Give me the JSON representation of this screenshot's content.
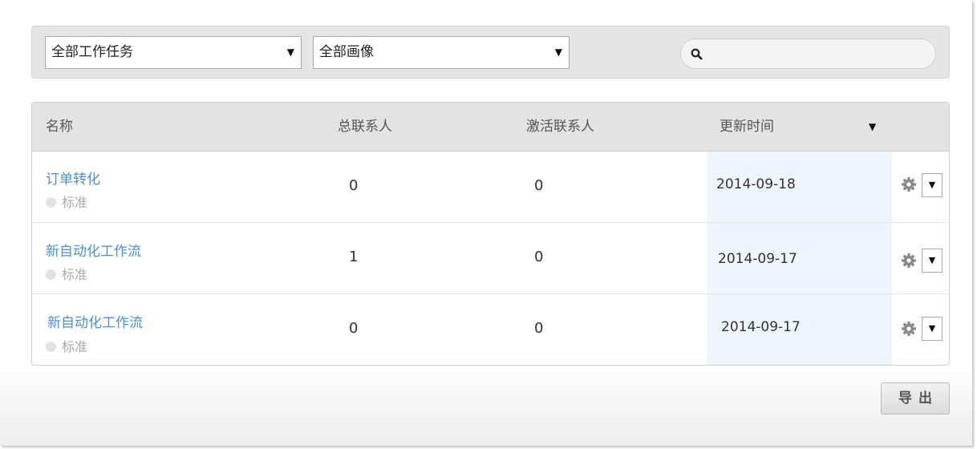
{
  "filters": {
    "task_select": "全部工作任务",
    "persona_select": "全部画像",
    "search_placeholder": ""
  },
  "table": {
    "headers": {
      "name": "名称",
      "total_contacts": "总联系人",
      "active_contacts": "激活联系人",
      "updated": "更新时间"
    },
    "rows": [
      {
        "name": "订单转化",
        "type": "标准",
        "total": "0",
        "active": "0",
        "updated": "2014-09-18"
      },
      {
        "name": "新自动化工作流",
        "type": "标准",
        "total": "1",
        "active": "0",
        "updated": "2014-09-17"
      },
      {
        "name": "新自动化工作流",
        "type": "标准",
        "total": "0",
        "active": "0",
        "updated": "2014-09-17"
      }
    ]
  },
  "export_label": "导出",
  "icons": [
    "search-icon",
    "gear-icon",
    "caret-down-icon"
  ],
  "colors": {
    "link": "#4a8fd4",
    "highlight": "#eef5fd",
    "header_bg": "#e3e3e3"
  }
}
